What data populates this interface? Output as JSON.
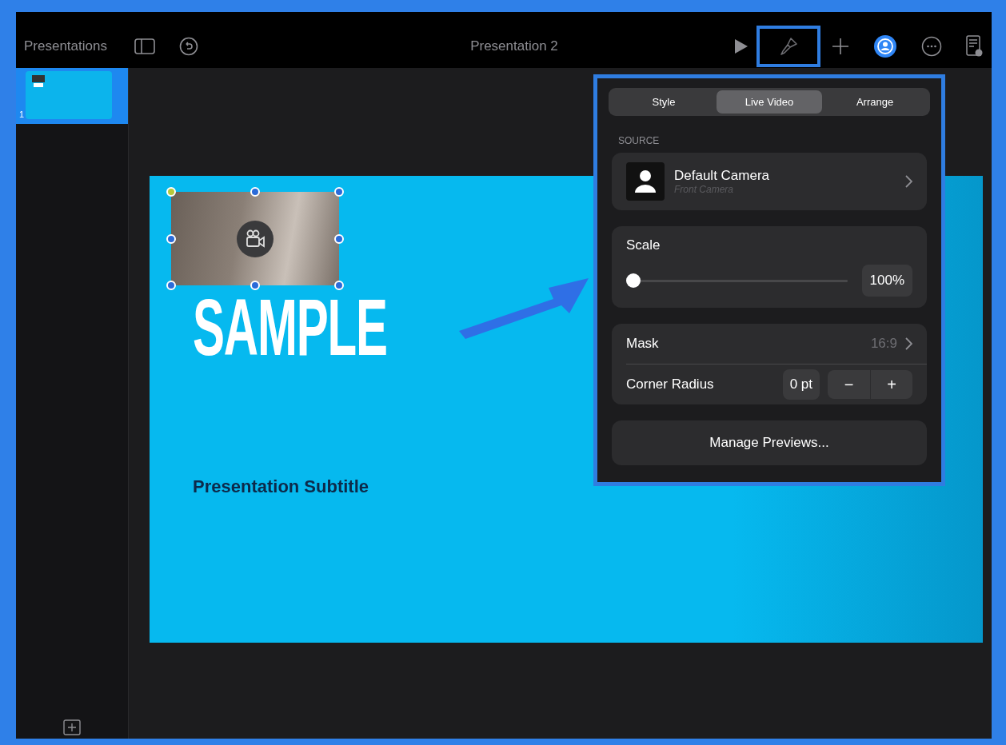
{
  "toolbar": {
    "back_label": "Presentations",
    "title": "Presentation 2",
    "format_selected": true
  },
  "slides": [
    {
      "number": "1",
      "selected": true
    }
  ],
  "slide": {
    "title": "SAMPLE",
    "subtitle": "Presentation Subtitle",
    "video_selected": true
  },
  "inspector": {
    "tabs": [
      {
        "label": "Style",
        "selected": false
      },
      {
        "label": "Live Video",
        "selected": true
      },
      {
        "label": "Arrange",
        "selected": false
      }
    ],
    "source_heading": "SOURCE",
    "source": {
      "name": "Default Camera",
      "detail": "Front Camera"
    },
    "scale": {
      "label": "Scale",
      "level": 0,
      "reading": "100%"
    },
    "mask": {
      "label": "Mask",
      "value": "16:9"
    },
    "corner_radius": {
      "label": "Corner Radius",
      "value": "0 pt",
      "minus": "−",
      "plus": "+"
    },
    "manage_button": "Manage Previews..."
  }
}
